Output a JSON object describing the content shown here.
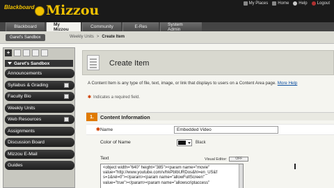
{
  "header": {
    "logo_prefix": "Blackboard",
    "logo_name": "Mizzou",
    "links": [
      "My Places",
      "Home",
      "Help",
      "Logout"
    ]
  },
  "tabs": [
    "Blackboard",
    "My Mizzou",
    "Community",
    "E-Res",
    "System Admin"
  ],
  "breadcrumb": {
    "course": "Garet's Sandbox",
    "path": [
      "Weekly Units",
      "Create Item"
    ]
  },
  "sidebar": {
    "title": "Garet's Sandbox",
    "items": [
      {
        "label": "Announcements",
        "checkbox": false
      },
      {
        "label": "Syllabus & Grading",
        "checkbox": true
      },
      {
        "label": "Faculty Bio",
        "checkbox": true
      },
      {
        "label": "Weekly Units",
        "checkbox": false
      },
      {
        "label": "Web Resources",
        "checkbox": true
      },
      {
        "label": "Assignments",
        "checkbox": false
      },
      {
        "label": "Discussion Board",
        "checkbox": false
      },
      {
        "label": "Mizzou E-Mail",
        "checkbox": false
      },
      {
        "label": "Guides",
        "checkbox": false
      }
    ]
  },
  "page": {
    "title": "Create Item",
    "description": "A Content Item is any type of file, text, image, or link that displays to users on a Content Area page.",
    "more_help": "More Help",
    "required_note": "Indicates a required field."
  },
  "section": {
    "number": "1.",
    "title": "Content Information"
  },
  "form": {
    "name_label": "Name",
    "name_value": "Embedded Video",
    "color_label": "Color of Name",
    "color_value": "Black",
    "text_label": "Text",
    "visual_editor_label": "Visual Editor:",
    "visual_editor_state": "OFF",
    "text_lines": [
      "<object width=\"640\" height=\"385\"><param name=\"movie\"",
      "value=\"http://www.youtube.com/v/hkPbIbURDos&hl=en_US&f",
      "s=1&rel=0\"></param><param name=\"allowFullScreen\"",
      "value=\"true\"></param><param name=\"allowscriptaccess\""
    ]
  },
  "colors": {
    "accent": "#e07a00",
    "logo_gold": "#f2c200",
    "banner": "#1a1a1a"
  }
}
